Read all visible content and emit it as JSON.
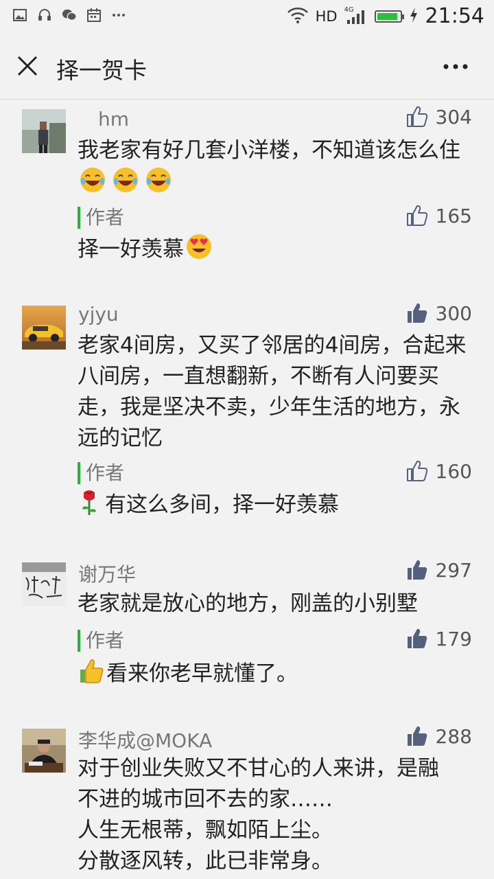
{
  "status_bar": {
    "network": "HD",
    "signal_type": "4G",
    "time": "21:54",
    "battery_level": 0.9
  },
  "header": {
    "title": "择一贺卡"
  },
  "comments": [
    {
      "name": "hm",
      "likes": "304",
      "liked": false,
      "text": "我老家有好几套小洋楼，不知道该怎么住",
      "reply": {
        "label": "作者",
        "likes": "165",
        "liked": false,
        "text": "择一好羡慕"
      }
    },
    {
      "name": "yjyu",
      "likes": "300",
      "liked": true,
      "text": "老家4间房，又买了邻居的4间房，合起来八间房，一直想翻新，不断有人问要买走，我是坚决不卖，少年生活的地方，永远的记忆",
      "reply": {
        "label": "作者",
        "likes": "160",
        "liked": false,
        "text": "有这么多间，择一好羡慕"
      }
    },
    {
      "name": "谢万华",
      "likes": "297",
      "liked": true,
      "text": "老家就是放心的地方，刚盖的小别墅",
      "reply": {
        "label": "作者",
        "likes": "179",
        "liked": true,
        "text": "看来你老早就懂了。"
      }
    },
    {
      "name": "李华成@MOKA",
      "likes": "288",
      "liked": true,
      "text_lines": [
        "对于创业失败又不甘心的人来讲，是融",
        "不进的城市回不去的家……",
        "人生无根蒂，飘如陌上尘。",
        "分散逐风转，此已非常身。"
      ]
    }
  ]
}
